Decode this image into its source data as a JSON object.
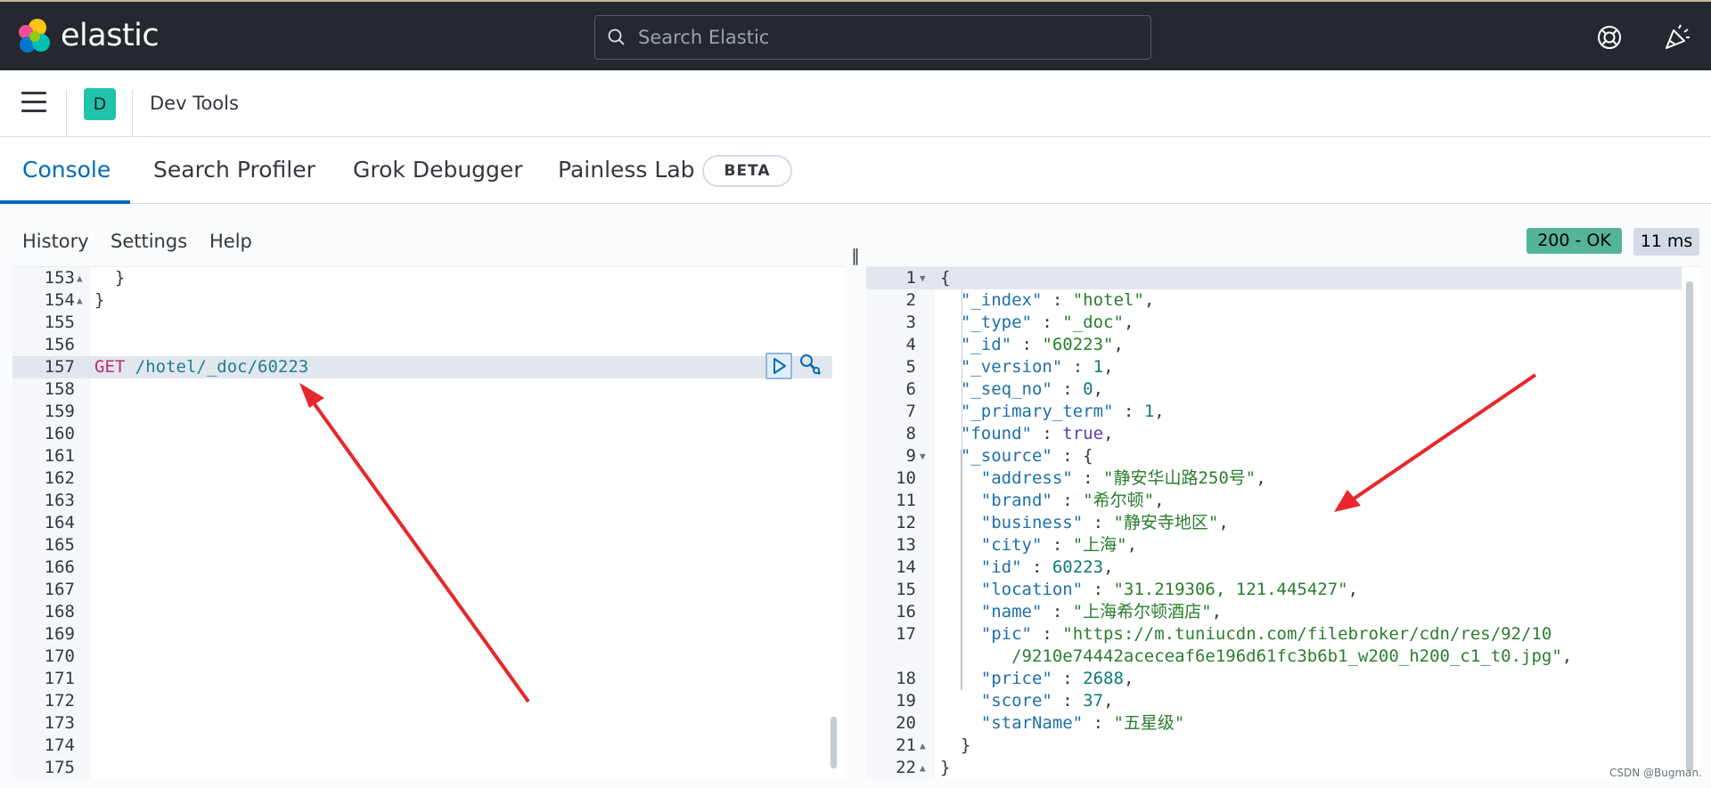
{
  "header": {
    "brand": "elastic",
    "search_placeholder": "Search Elastic"
  },
  "subheader": {
    "space_initial": "D",
    "page_title": "Dev Tools"
  },
  "tabs": [
    {
      "label": "Console",
      "active": true
    },
    {
      "label": "Search Profiler",
      "active": false
    },
    {
      "label": "Grok Debugger",
      "active": false
    },
    {
      "label": "Painless Lab",
      "active": false
    }
  ],
  "beta_badge": "BETA",
  "toolbar": {
    "history": "History",
    "settings": "Settings",
    "help": "Help",
    "status": "200 - OK",
    "time": "11 ms"
  },
  "request_editor": {
    "lines": [
      {
        "n": "153",
        "fold": "▲",
        "text": "  }"
      },
      {
        "n": "154",
        "fold": "▲",
        "text": "}"
      },
      {
        "n": "155",
        "fold": "",
        "text": ""
      },
      {
        "n": "156",
        "fold": "",
        "text": ""
      },
      {
        "n": "157",
        "fold": "",
        "method": "GET",
        "path": " /hotel/_doc/60223"
      },
      {
        "n": "158",
        "fold": "",
        "text": ""
      },
      {
        "n": "159",
        "fold": "",
        "text": ""
      },
      {
        "n": "160",
        "fold": "",
        "text": ""
      },
      {
        "n": "161",
        "fold": "",
        "text": ""
      },
      {
        "n": "162",
        "fold": "",
        "text": ""
      },
      {
        "n": "163",
        "fold": "",
        "text": ""
      },
      {
        "n": "164",
        "fold": "",
        "text": ""
      },
      {
        "n": "165",
        "fold": "",
        "text": ""
      },
      {
        "n": "166",
        "fold": "",
        "text": ""
      },
      {
        "n": "167",
        "fold": "",
        "text": ""
      },
      {
        "n": "168",
        "fold": "",
        "text": ""
      },
      {
        "n": "169",
        "fold": "",
        "text": ""
      },
      {
        "n": "170",
        "fold": "",
        "text": ""
      },
      {
        "n": "171",
        "fold": "",
        "text": ""
      },
      {
        "n": "172",
        "fold": "",
        "text": ""
      },
      {
        "n": "173",
        "fold": "",
        "text": ""
      },
      {
        "n": "174",
        "fold": "",
        "text": ""
      },
      {
        "n": "175",
        "fold": "",
        "text": ""
      }
    ]
  },
  "response_editor": {
    "lines": [
      {
        "n": "1",
        "fold": "▼",
        "parts": [
          [
            "punc",
            "{"
          ]
        ]
      },
      {
        "n": "2",
        "fold": "",
        "parts": [
          [
            "punc",
            "  "
          ],
          [
            "key",
            "\"_index\""
          ],
          [
            "punc",
            " : "
          ],
          [
            "str",
            "\"hotel\""
          ],
          [
            "punc",
            ","
          ]
        ]
      },
      {
        "n": "3",
        "fold": "",
        "parts": [
          [
            "punc",
            "  "
          ],
          [
            "key",
            "\"_type\""
          ],
          [
            "punc",
            " : "
          ],
          [
            "str",
            "\"_doc\""
          ],
          [
            "punc",
            ","
          ]
        ]
      },
      {
        "n": "4",
        "fold": "",
        "parts": [
          [
            "punc",
            "  "
          ],
          [
            "key",
            "\"_id\""
          ],
          [
            "punc",
            " : "
          ],
          [
            "str",
            "\"60223\""
          ],
          [
            "punc",
            ","
          ]
        ]
      },
      {
        "n": "5",
        "fold": "",
        "parts": [
          [
            "punc",
            "  "
          ],
          [
            "key",
            "\"_version\""
          ],
          [
            "punc",
            " : "
          ],
          [
            "num",
            "1"
          ],
          [
            "punc",
            ","
          ]
        ]
      },
      {
        "n": "6",
        "fold": "",
        "parts": [
          [
            "punc",
            "  "
          ],
          [
            "key",
            "\"_seq_no\""
          ],
          [
            "punc",
            " : "
          ],
          [
            "num",
            "0"
          ],
          [
            "punc",
            ","
          ]
        ]
      },
      {
        "n": "7",
        "fold": "",
        "parts": [
          [
            "punc",
            "  "
          ],
          [
            "key",
            "\"_primary_term\""
          ],
          [
            "punc",
            " : "
          ],
          [
            "num",
            "1"
          ],
          [
            "punc",
            ","
          ]
        ]
      },
      {
        "n": "8",
        "fold": "",
        "parts": [
          [
            "punc",
            "  "
          ],
          [
            "key",
            "\"found\""
          ],
          [
            "punc",
            " : "
          ],
          [
            "bool",
            "true"
          ],
          [
            "punc",
            ","
          ]
        ]
      },
      {
        "n": "9",
        "fold": "▼",
        "parts": [
          [
            "punc",
            "  "
          ],
          [
            "key",
            "\"_source\""
          ],
          [
            "punc",
            " : {"
          ]
        ]
      },
      {
        "n": "10",
        "fold": "",
        "parts": [
          [
            "punc",
            "    "
          ],
          [
            "key",
            "\"address\""
          ],
          [
            "punc",
            " : "
          ],
          [
            "str",
            "\"静安华山路250号\""
          ],
          [
            "punc",
            ","
          ]
        ]
      },
      {
        "n": "11",
        "fold": "",
        "parts": [
          [
            "punc",
            "    "
          ],
          [
            "key",
            "\"brand\""
          ],
          [
            "punc",
            " : "
          ],
          [
            "str",
            "\"希尔顿\""
          ],
          [
            "punc",
            ","
          ]
        ]
      },
      {
        "n": "12",
        "fold": "",
        "parts": [
          [
            "punc",
            "    "
          ],
          [
            "key",
            "\"business\""
          ],
          [
            "punc",
            " : "
          ],
          [
            "str",
            "\"静安寺地区\""
          ],
          [
            "punc",
            ","
          ]
        ]
      },
      {
        "n": "13",
        "fold": "",
        "parts": [
          [
            "punc",
            "    "
          ],
          [
            "key",
            "\"city\""
          ],
          [
            "punc",
            " : "
          ],
          [
            "str",
            "\"上海\""
          ],
          [
            "punc",
            ","
          ]
        ]
      },
      {
        "n": "14",
        "fold": "",
        "parts": [
          [
            "punc",
            "    "
          ],
          [
            "key",
            "\"id\""
          ],
          [
            "punc",
            " : "
          ],
          [
            "num",
            "60223"
          ],
          [
            "punc",
            ","
          ]
        ]
      },
      {
        "n": "15",
        "fold": "",
        "parts": [
          [
            "punc",
            "    "
          ],
          [
            "key",
            "\"location\""
          ],
          [
            "punc",
            " : "
          ],
          [
            "str",
            "\"31.219306, 121.445427\""
          ],
          [
            "punc",
            ","
          ]
        ]
      },
      {
        "n": "16",
        "fold": "",
        "parts": [
          [
            "punc",
            "    "
          ],
          [
            "key",
            "\"name\""
          ],
          [
            "punc",
            " : "
          ],
          [
            "str",
            "\"上海希尔顿酒店\""
          ],
          [
            "punc",
            ","
          ]
        ]
      },
      {
        "n": "17",
        "fold": "",
        "parts": [
          [
            "punc",
            "    "
          ],
          [
            "key",
            "\"pic\""
          ],
          [
            "punc",
            " : "
          ],
          [
            "str",
            "\"https://m.tuniucdn.com/filebroker/cdn/res/92/10"
          ]
        ]
      },
      {
        "n": "",
        "fold": "",
        "parts": [
          [
            "punc",
            "       "
          ],
          [
            "str",
            "/9210e74442aceceaf6e196d61fc3b6b1_w200_h200_c1_t0.jpg\""
          ],
          [
            "punc",
            ","
          ]
        ]
      },
      {
        "n": "18",
        "fold": "",
        "parts": [
          [
            "punc",
            "    "
          ],
          [
            "key",
            "\"price\""
          ],
          [
            "punc",
            " : "
          ],
          [
            "num",
            "2688"
          ],
          [
            "punc",
            ","
          ]
        ]
      },
      {
        "n": "19",
        "fold": "",
        "parts": [
          [
            "punc",
            "    "
          ],
          [
            "key",
            "\"score\""
          ],
          [
            "punc",
            " : "
          ],
          [
            "num",
            "37"
          ],
          [
            "punc",
            ","
          ]
        ]
      },
      {
        "n": "20",
        "fold": "",
        "parts": [
          [
            "punc",
            "    "
          ],
          [
            "key",
            "\"starName\""
          ],
          [
            "punc",
            " : "
          ],
          [
            "str",
            "\"五星级\""
          ]
        ]
      },
      {
        "n": "21",
        "fold": "▲",
        "parts": [
          [
            "punc",
            "  }"
          ]
        ]
      },
      {
        "n": "22",
        "fold": "▲",
        "parts": [
          [
            "punc",
            "}"
          ]
        ]
      }
    ]
  },
  "watermark": "CSDN @Bugman.",
  "icons": {
    "search": "search-icon",
    "help": "help-icon",
    "news": "newsfeed-icon",
    "menu": "menu-icon",
    "play": "play-icon",
    "wrench": "wrench-icon"
  },
  "colors": {
    "accent": "#006bb8",
    "status_ok": "#54b399",
    "annotation_arrow": "#e8262b"
  }
}
